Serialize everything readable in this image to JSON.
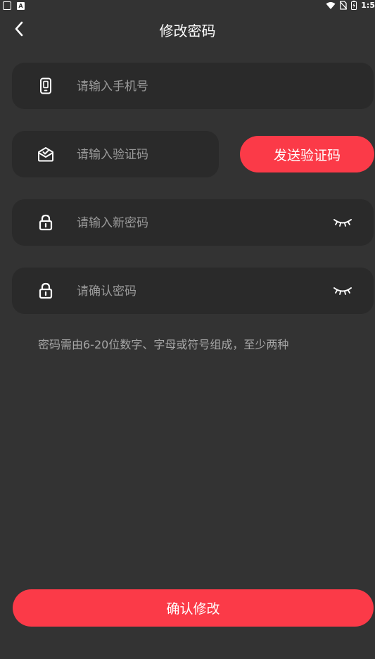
{
  "status_bar": {
    "time": "1:5"
  },
  "header": {
    "title": "修改密码"
  },
  "form": {
    "phone_placeholder": "请输入手机号",
    "code_placeholder": "请输入验证码",
    "send_code_label": "发送验证码",
    "new_password_placeholder": "请输入新密码",
    "confirm_password_placeholder": "请确认密码",
    "hint": "密码需由6-20位数字、字母或符号组成，至少两种"
  },
  "actions": {
    "confirm_label": "确认修改"
  },
  "colors": {
    "accent": "#fb3a48",
    "background": "#333333",
    "field_bg": "#2a2a2a"
  },
  "icons": [
    "back-arrow-icon",
    "phone-icon",
    "verify-mail-icon",
    "lock-icon",
    "eye-closed-icon"
  ]
}
